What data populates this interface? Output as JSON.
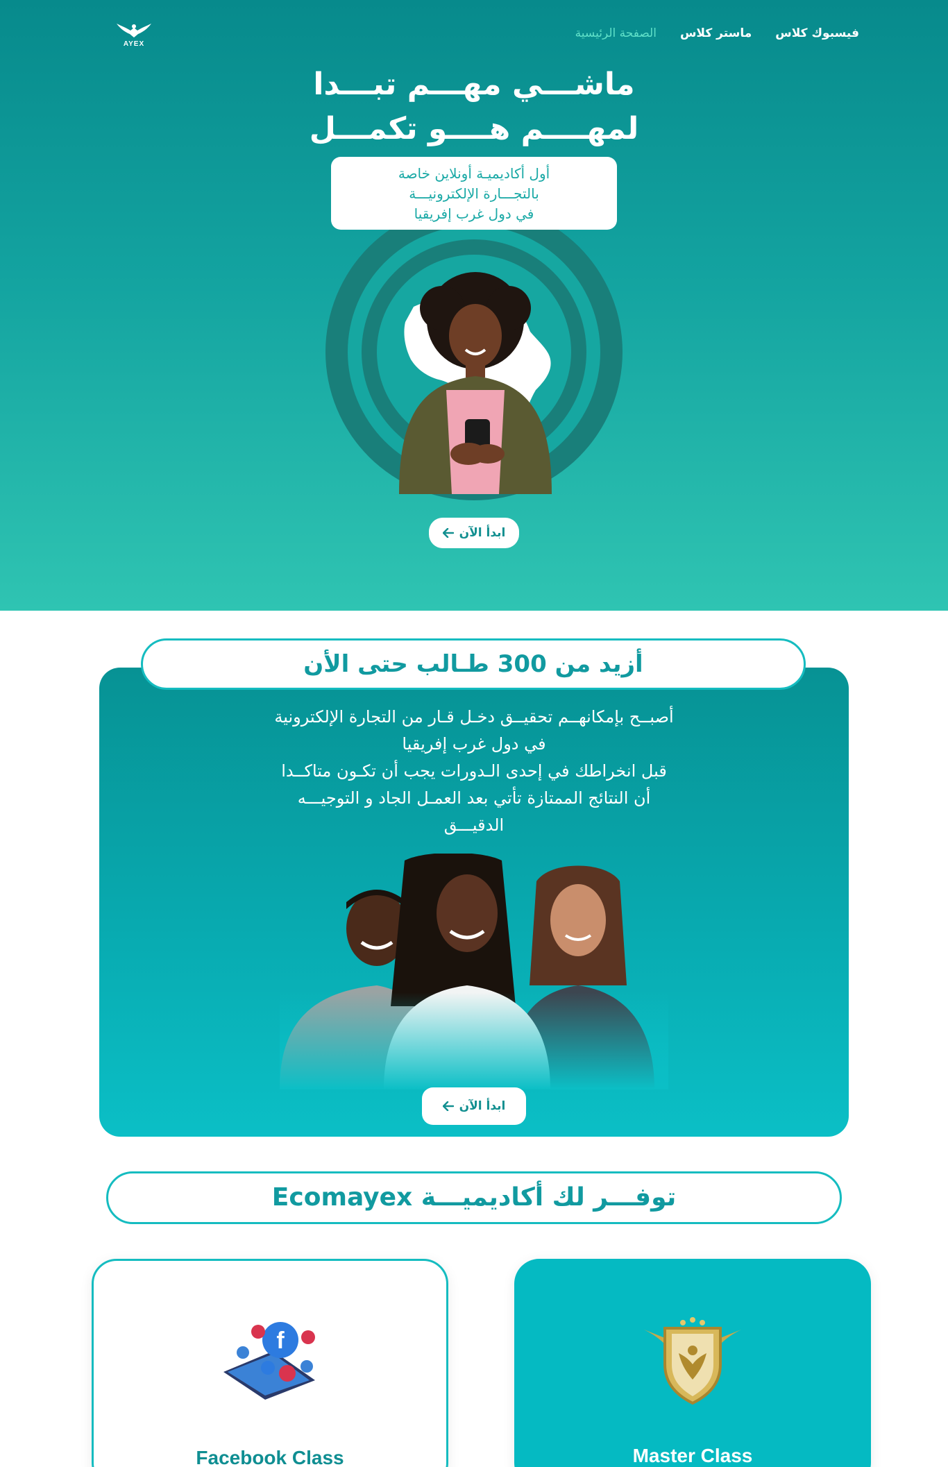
{
  "header": {
    "logo_text": "AYEX",
    "nav": [
      "فيسبوك كلاس",
      "ماستر كلاس",
      "الصفحة الرئيسية"
    ],
    "active_nav": "الصفحة الرئيسية"
  },
  "hero": {
    "title_line1": "ماشـــي مهـــم تبـــدا",
    "title_line2": "لمهــــم هــــو تكمـــل",
    "subtitle_lines": [
      "أول أكاديميـة أونلاين خاصة",
      "بالتجـــارة الإلكترونيـــة",
      "في دول غرب إفريقيا"
    ],
    "cta": "ابدأ الآن"
  },
  "students": {
    "heading": "أزيد من 300 طـالب حتى الأن",
    "body_lines": [
      "أصبــح بإمكانهــم تحقيــق دخـل قـار من التجارة الإلكترونية",
      "في دول غرب إفريقيا",
      "قبل انخراطك في إحدى الـدورات يجب أن تكـون متاكــدا",
      "أن النتائج الممتازة تأتي بعد العمـل الجاد و التوجيـــه",
      "الدقيـــق"
    ],
    "cta": "ابدأ الآن"
  },
  "offers": {
    "heading": "توفـــر لك أكاديميـــة Ecomayex",
    "cards": [
      {
        "title": "Facebook Class",
        "icon": "facebook-social-icon"
      },
      {
        "title": "Master Class",
        "icon": "master-class-badge-icon"
      }
    ]
  },
  "colors": {
    "primary": "#0a9b9c",
    "accent": "#15bcc0",
    "active_nav": "#5fe0c8",
    "white": "#ffffff"
  }
}
